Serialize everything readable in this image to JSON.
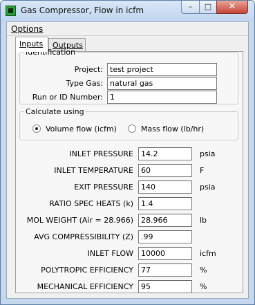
{
  "window": {
    "title": "Gas Compressor, Flow in icfm",
    "minimize_glyph": "–",
    "maximize_glyph": "□",
    "close_glyph": "✕"
  },
  "menu": {
    "options_label": "Options"
  },
  "tabs": [
    {
      "label": "Inputs",
      "active": true
    },
    {
      "label": "Outputs",
      "active": false
    }
  ],
  "identification": {
    "legend": "Identification",
    "project_label": "Project:",
    "project_value": "test project",
    "type_gas_label": "Type Gas:",
    "type_gas_value": "natural gas",
    "run_label": "Run or ID Number:",
    "run_value": "1"
  },
  "calculate": {
    "legend": "Calculate using",
    "options": [
      {
        "label": "Volume flow (icfm)",
        "selected": true
      },
      {
        "label": "Mass flow (lb/hr)",
        "selected": false
      }
    ]
  },
  "inputs": [
    {
      "label": "INLET PRESSURE",
      "value": "14.2",
      "unit": "psia"
    },
    {
      "label": "INLET TEMPERATURE",
      "value": "60",
      "unit": "F"
    },
    {
      "label": "EXIT PRESSURE",
      "value": "140",
      "unit": "psia"
    },
    {
      "label": "RATIO SPEC HEATS (k)",
      "value": "1.4",
      "unit": ""
    },
    {
      "label": "MOL WEIGHT (Air = 28.966)",
      "value": "28.966",
      "unit": "lb"
    },
    {
      "label": "AVG COMPRESSIBILITY (Z)",
      "value": ".99",
      "unit": ""
    },
    {
      "label": "INLET FLOW",
      "value": "10000",
      "unit": "icfm"
    },
    {
      "label": "POLYTROPIC EFFICIENCY",
      "value": "77",
      "unit": "%"
    },
    {
      "label": "MECHANICAL EFFICIENCY",
      "value": "95",
      "unit": "%"
    }
  ]
}
